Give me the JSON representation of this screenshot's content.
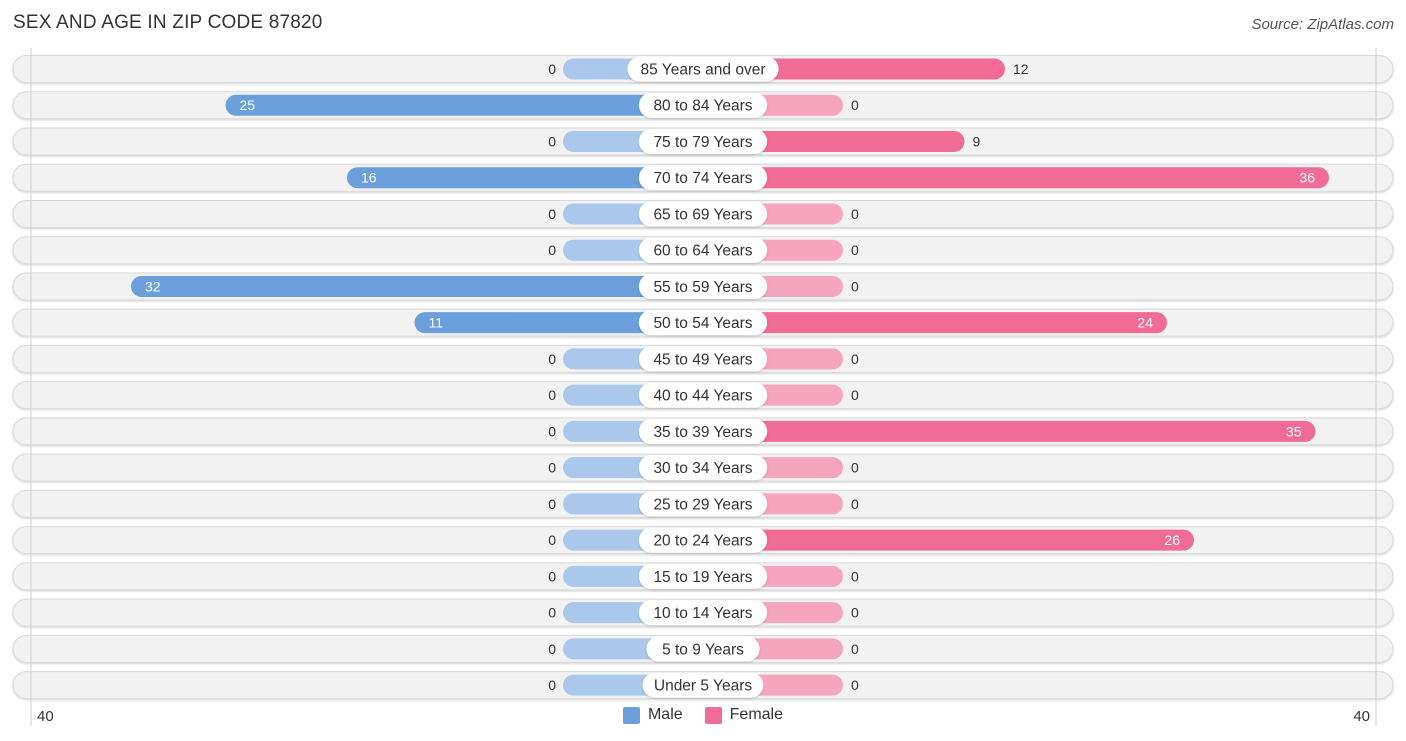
{
  "header": {
    "title": "SEX AND AGE IN ZIP CODE 87820",
    "source": "Source: ZipAtlas.com"
  },
  "colors": {
    "male_strong": "#6a9fdb",
    "male_light": "#a9c8ec",
    "female_strong": "#f06b95",
    "female_light": "#f6a5bf",
    "row_bg": "#f2f2f2",
    "row_border": "#d9d9d9",
    "label_bg": "#ffffff"
  },
  "axis": {
    "left_label": "40",
    "right_label": "40"
  },
  "legend": {
    "male_label": "Male",
    "female_label": "Female"
  },
  "chart_data": {
    "type": "bar",
    "orientation": "horizontal-diverging",
    "title": "SEX AND AGE IN ZIP CODE 87820",
    "xlabel": "",
    "ylabel": "",
    "xlim": [
      -40,
      40
    ],
    "tick_labels": [
      "40",
      "40"
    ],
    "legend_position": "bottom-center",
    "grid": false,
    "categories": [
      "85 Years and over",
      "80 to 84 Years",
      "75 to 79 Years",
      "70 to 74 Years",
      "65 to 69 Years",
      "60 to 64 Years",
      "55 to 59 Years",
      "50 to 54 Years",
      "45 to 49 Years",
      "40 to 44 Years",
      "35 to 39 Years",
      "30 to 34 Years",
      "25 to 29 Years",
      "20 to 24 Years",
      "15 to 19 Years",
      "10 to 14 Years",
      "5 to 9 Years",
      "Under 5 Years"
    ],
    "series": [
      {
        "name": "Male",
        "values": [
          0,
          25,
          0,
          16,
          0,
          0,
          32,
          11,
          0,
          0,
          0,
          0,
          0,
          0,
          0,
          0,
          0,
          0
        ]
      },
      {
        "name": "Female",
        "values": [
          12,
          0,
          9,
          36,
          0,
          0,
          0,
          24,
          0,
          0,
          35,
          0,
          0,
          26,
          0,
          0,
          0,
          0
        ]
      }
    ]
  }
}
